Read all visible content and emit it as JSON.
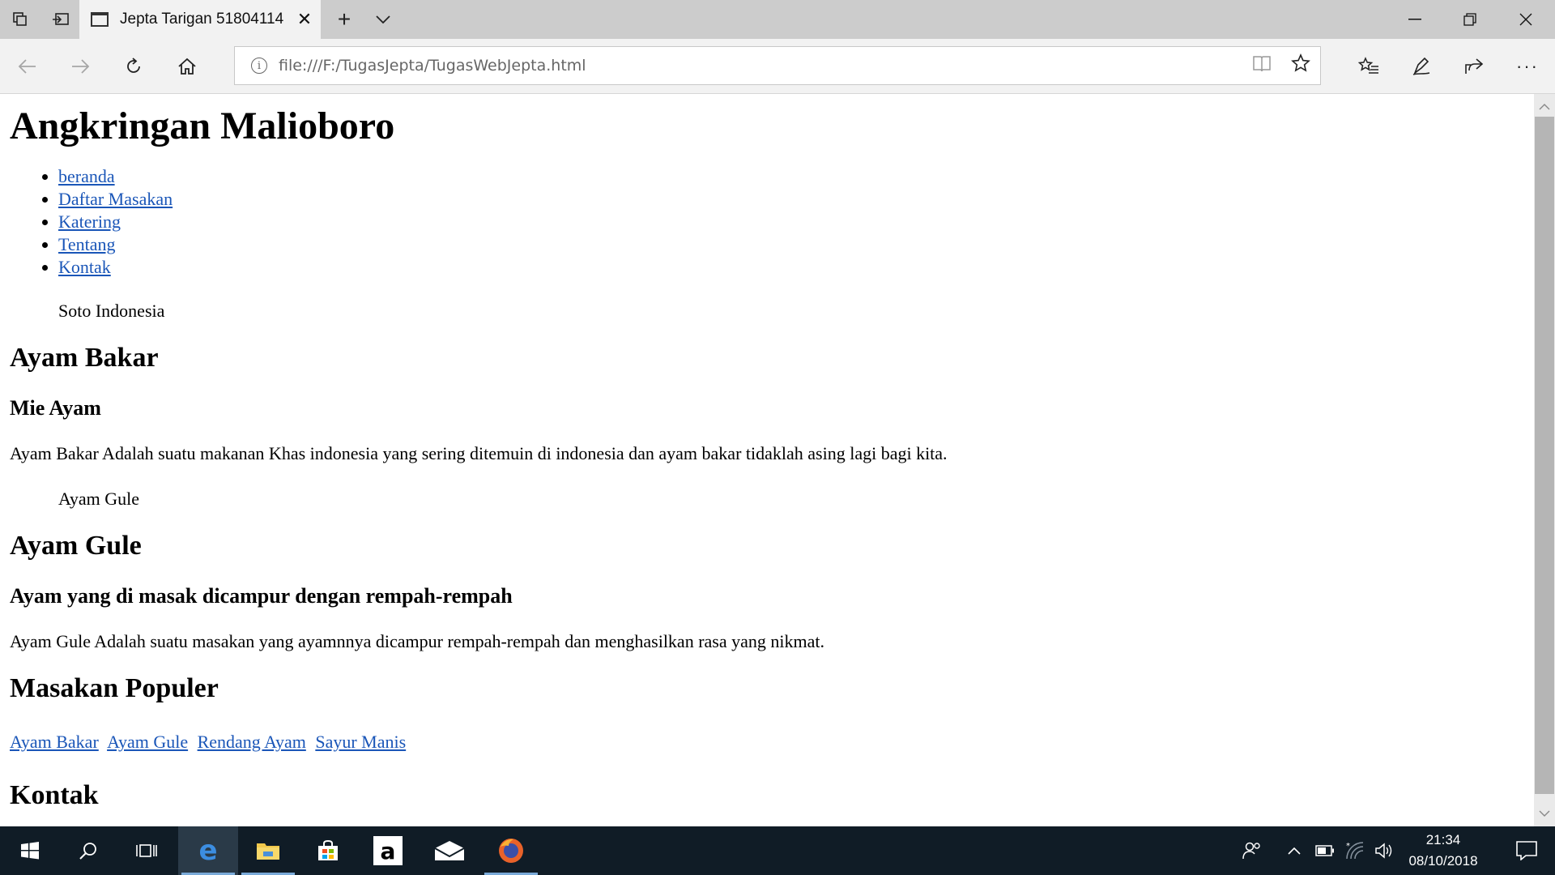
{
  "browser": {
    "tab_title": "Jepta Tarigan 51804114",
    "url": "file:///F:/TugasJepta/TugasWebJepta.html",
    "icons": {
      "tab_preview": "tabs-icon",
      "set_aside": "set-aside-icon",
      "tab_close": "close-icon",
      "new_tab": "plus-icon",
      "tab_menu": "chevron-down-icon",
      "minimize": "minimize-icon",
      "restore": "restore-icon",
      "close": "close-icon",
      "back": "back-arrow-icon",
      "forward": "forward-arrow-icon",
      "refresh": "refresh-icon",
      "home": "home-icon",
      "info": "info-icon",
      "reading_view": "book-icon",
      "favorite": "star-icon",
      "favorites_hub": "favorites-list-icon",
      "notes": "pen-icon",
      "share": "share-icon",
      "more": "ellipsis-icon"
    }
  },
  "page": {
    "title": "Angkringan Malioboro",
    "nav": [
      "beranda",
      "Daftar Masakan",
      "Katering",
      "Tentang",
      "Kontak"
    ],
    "section1": {
      "caption": "Soto Indonesia",
      "heading": "Ayam Bakar",
      "subheading": "Mie Ayam",
      "text": "Ayam Bakar Adalah suatu makanan Khas indonesia yang sering ditemuin di indonesia dan ayam bakar tidaklah asing lagi bagi kita."
    },
    "section2": {
      "caption": "Ayam Gule",
      "heading": "Ayam Gule",
      "subheading": "Ayam yang di masak dicampur dengan rempah-rempah",
      "text": "Ayam Gule Adalah suatu masakan yang ayamnnya dicampur rempah-rempah dan menghasilkan rasa yang nikmat."
    },
    "popular": {
      "heading": "Masakan Populer",
      "links": [
        "Ayam Bakar",
        "Ayam Gule",
        "Rendang Ayam",
        "Sayur Manis"
      ]
    },
    "contact_heading": "Kontak"
  },
  "taskbar": {
    "time": "21:34",
    "date": "08/10/2018",
    "apps": [
      "windows-start-icon",
      "search-icon",
      "task-view-icon",
      "edge-icon",
      "file-explorer-icon",
      "store-icon",
      "amazon-icon",
      "mail-icon",
      "firefox-icon"
    ]
  }
}
